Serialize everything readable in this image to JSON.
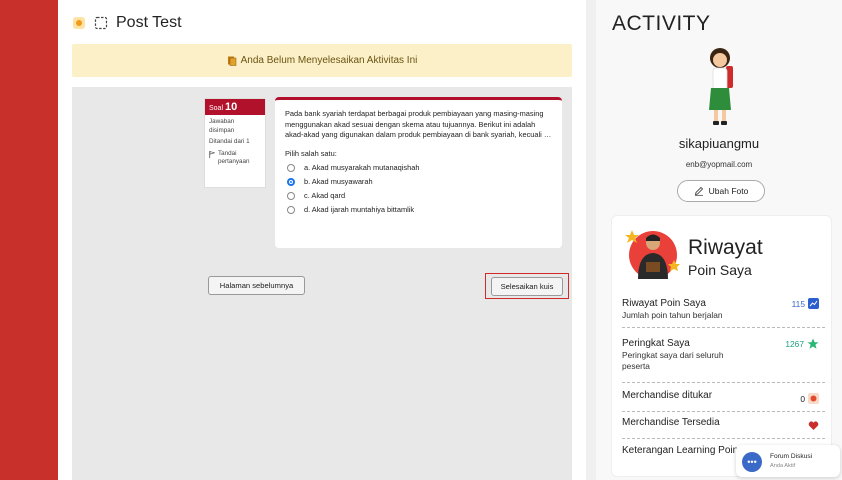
{
  "header": {
    "title": "Post Test"
  },
  "banner": {
    "text": "Anda Belum Menyelesaikan Aktivitas Ini"
  },
  "question_nav": {
    "label": "Soal",
    "number": "10",
    "status": "Jawaban disimpan",
    "marked": "Ditandai dari 1",
    "flag_label": "Tandai pertanyaan"
  },
  "question": {
    "text": "Pada bank syariah terdapat berbagai produk pembiayaan yang masing-masing menggunakan akad sesuai dengan skema atau tujuannya. Berikut ini adalah akad-akad yang digunakan dalam produk pembiayaan di bank syariah, kecuali …",
    "prompt": "Pilih salah satu:",
    "options": [
      {
        "label": "a. Akad musyarakah mutanaqishah",
        "selected": false
      },
      {
        "label": "b. Akad musyawarah",
        "selected": true
      },
      {
        "label": "c. Akad qard",
        "selected": false
      },
      {
        "label": "d. Akad ijarah muntahiya bittamlik",
        "selected": false
      }
    ]
  },
  "buttons": {
    "prev": "Halaman sebelumnya",
    "finish": "Selesaikan kuis"
  },
  "activity": {
    "title": "ACTIVITY",
    "username": "sikapiuangmu",
    "email": "enb@yopmail.com",
    "change_photo": "Ubah Foto"
  },
  "points": {
    "title": "Riwayat",
    "subtitle": "Poin Saya",
    "rows": [
      {
        "title": "Riwayat Poin Saya",
        "sub": "Jumlah poin tahun berjalan",
        "value": "115",
        "icon": "trend-chart-icon"
      },
      {
        "title": "Peringkat Saya",
        "sub": "Peringkat saya dari seluruh peserta",
        "value": "1267",
        "icon": "star-icon"
      },
      {
        "title": "Merchandise ditukar",
        "sub": "",
        "value": "0",
        "icon": "gift-icon"
      },
      {
        "title": "Merchandise Tersedia",
        "sub": "",
        "value": "",
        "icon": "heart-icon"
      },
      {
        "title": "Keterangan Learning Poin",
        "sub": "",
        "value": "",
        "icon": ""
      }
    ]
  },
  "forum": {
    "title": "Forum Diskusi",
    "status": "Anda Aktif"
  },
  "colors": {
    "sidebar": "#c8302c",
    "accent": "#b2112b",
    "banner_bg": "#fcf0c8",
    "radio_selected": "#1a73e8"
  }
}
